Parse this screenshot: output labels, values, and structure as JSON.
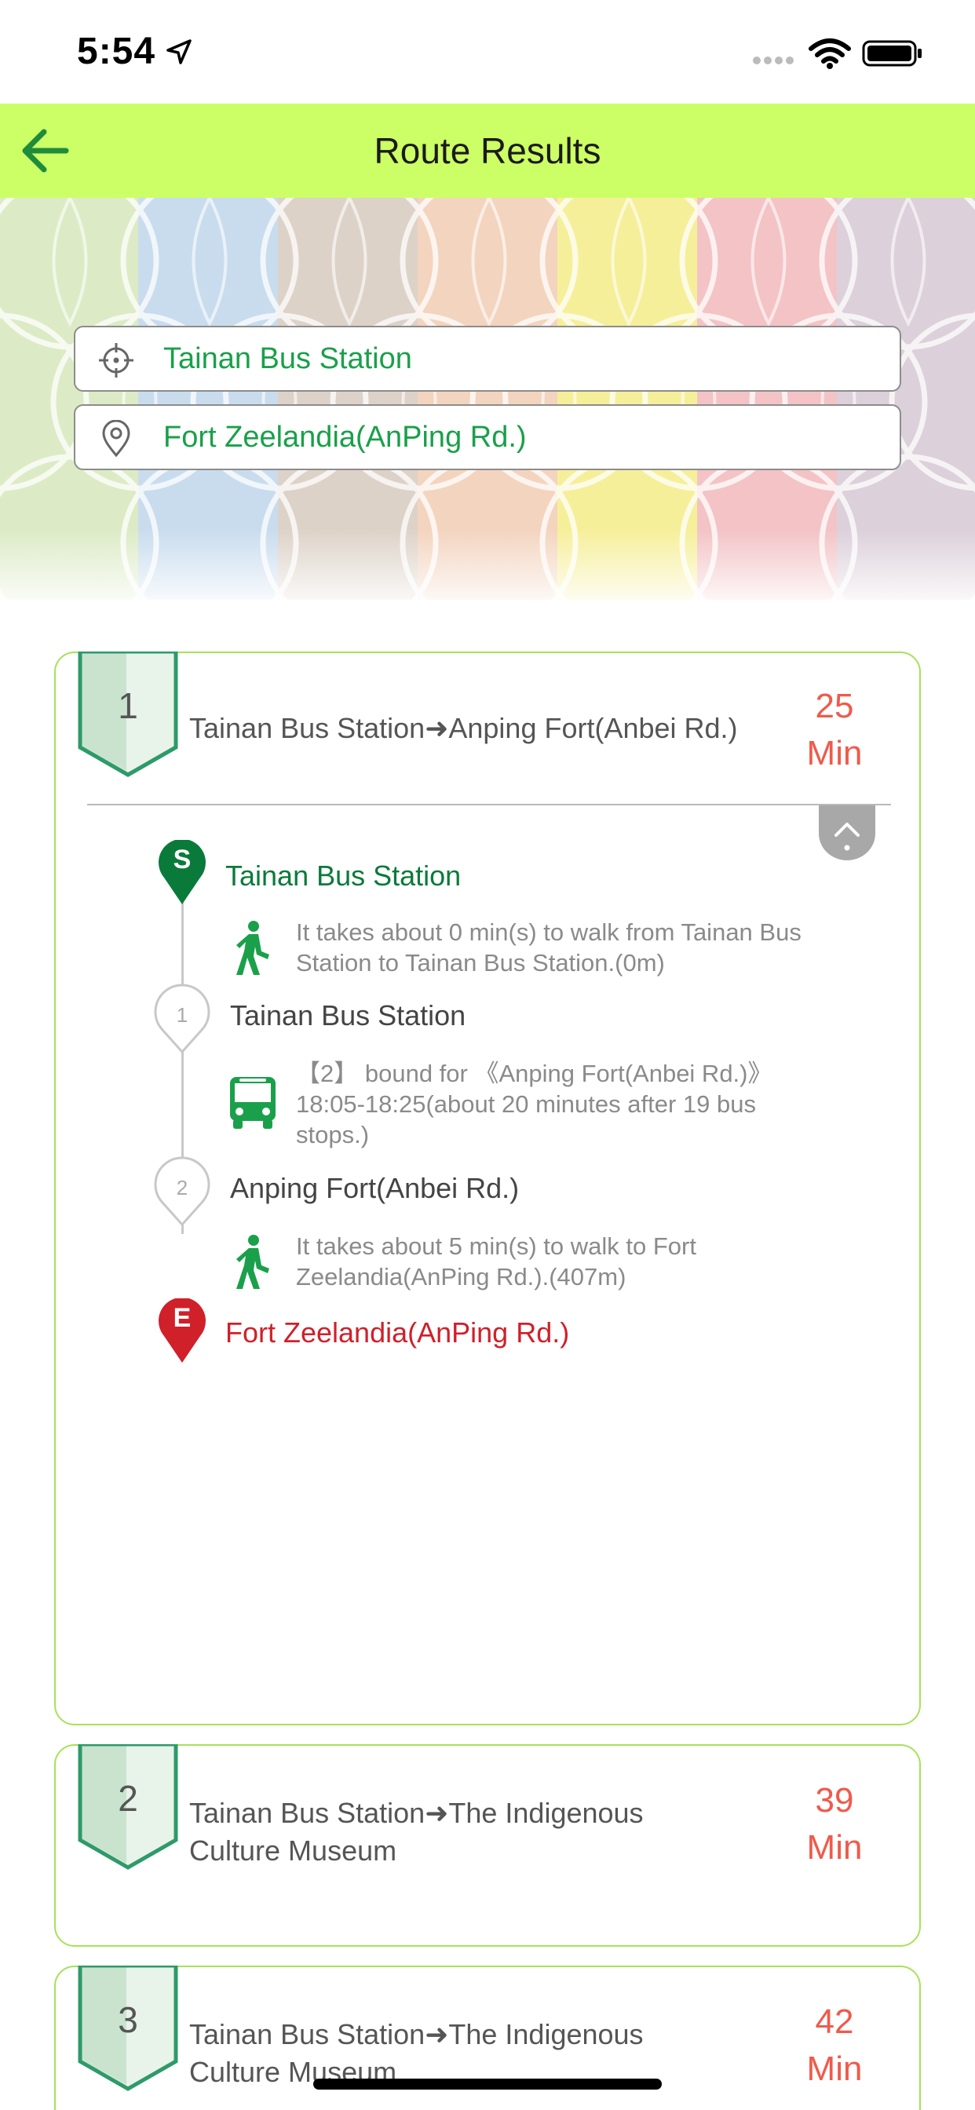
{
  "status_bar": {
    "time": "5:54"
  },
  "nav": {
    "title": "Route Results"
  },
  "search": {
    "from": "Tainan Bus Station",
    "to": "Fort Zeelandia(AnPing Rd.)"
  },
  "routes": [
    {
      "rank": "1",
      "title": "Tainan Bus Station➜Anping Fort(Anbei Rd.)",
      "time_value": "25",
      "time_unit": "Min",
      "steps": {
        "start_badge": "S",
        "start_name": "Tainan Bus Station",
        "walk1": "It takes about 0 min(s) to walk from Tainan Bus Station to Tainan Bus Station.(0m)",
        "stop1_num": "1",
        "stop1_name": "Tainan Bus Station",
        "bus_line1": "【2】 bound for 《Anping Fort(Anbei Rd.)》",
        "bus_line2": "18:05-18:25(about 20 minutes after 19 bus stops.)",
        "stop2_num": "2",
        "stop2_name": "Anping Fort(Anbei Rd.)",
        "walk2": "It takes about 5 min(s) to walk to Fort Zeelandia(AnPing Rd.).(407m)",
        "end_badge": "E",
        "end_name": "Fort Zeelandia(AnPing Rd.)"
      }
    },
    {
      "rank": "2",
      "title": "Tainan Bus Station➜The Indigenous Culture Museum",
      "time_value": "39",
      "time_unit": "Min"
    },
    {
      "rank": "3",
      "title": "Tainan Bus Station➜The Indigenous Culture Museum",
      "time_value": "42",
      "time_unit": "Min"
    }
  ],
  "colors": {
    "nav_bg": "#ccff66",
    "accent_green": "#1aa04a",
    "start_pin": "#0a7a3a",
    "end_pin": "#d0202a",
    "time_red": "#f05a4a",
    "card_border": "#a7e25a"
  },
  "icons": {
    "back": "arrow-left-icon",
    "from": "crosshair-icon",
    "to": "location-pin-icon",
    "walk": "walking-person-icon",
    "bus": "bus-icon",
    "collapse": "chevron-up-icon"
  }
}
